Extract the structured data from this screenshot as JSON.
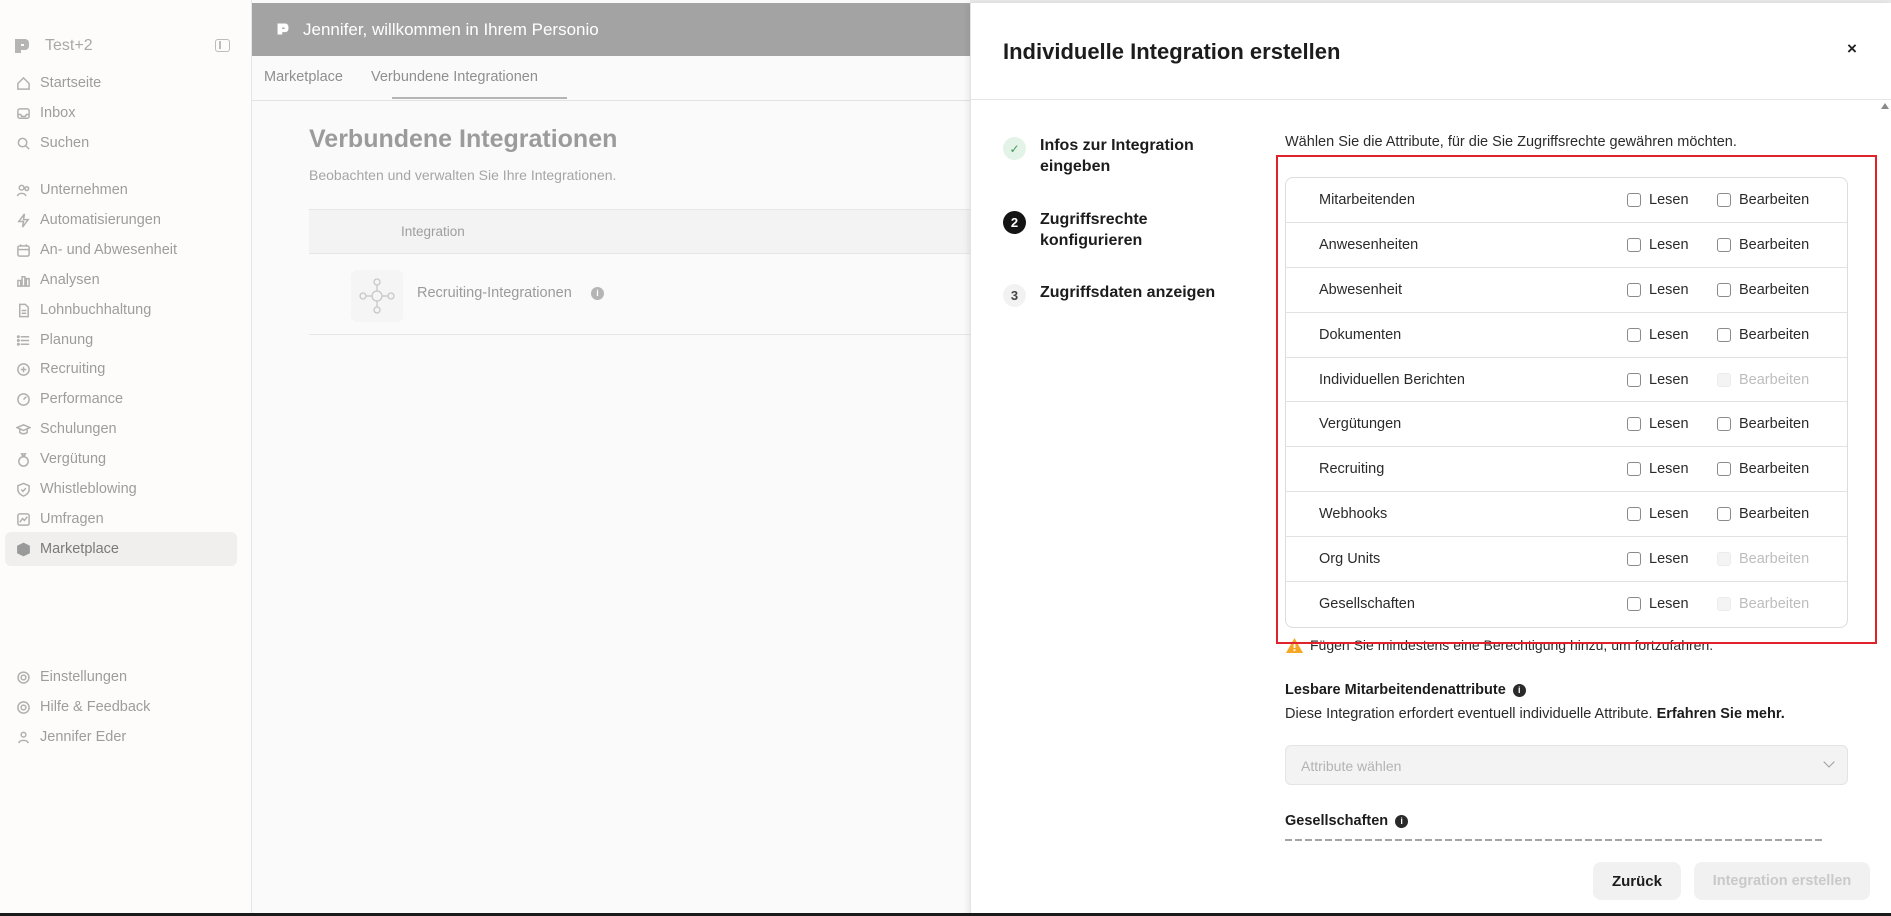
{
  "sidebar": {
    "company": "Test+2",
    "nav": [
      {
        "label": "Startseite",
        "icon": "home-icon"
      },
      {
        "label": "Inbox",
        "icon": "inbox-icon"
      },
      {
        "label": "Suchen",
        "icon": "search-icon"
      },
      {
        "label": "Unternehmen",
        "icon": "people-icon"
      },
      {
        "label": "Automatisierungen",
        "icon": "lightning-icon"
      },
      {
        "label": "An- und Abwesenheit",
        "icon": "calendar-icon"
      },
      {
        "label": "Analysen",
        "icon": "chart-icon"
      },
      {
        "label": "Lohnbuchhaltung",
        "icon": "document-icon"
      },
      {
        "label": "Planung",
        "icon": "list-icon"
      },
      {
        "label": "Recruiting",
        "icon": "recruiting-icon"
      },
      {
        "label": "Performance",
        "icon": "gauge-icon"
      },
      {
        "label": "Schulungen",
        "icon": "graduation-icon"
      },
      {
        "label": "Vergütung",
        "icon": "money-bag-icon"
      },
      {
        "label": "Whistleblowing",
        "icon": "shield-icon"
      },
      {
        "label": "Umfragen",
        "icon": "trend-icon"
      },
      {
        "label": "Marketplace",
        "icon": "cube-icon",
        "active": true
      }
    ],
    "bottom": [
      {
        "label": "Einstellungen",
        "icon": "gear-icon"
      },
      {
        "label": "Hilfe & Feedback",
        "icon": "help-icon"
      },
      {
        "label": "Jennifer Eder",
        "icon": "user-icon"
      }
    ]
  },
  "main": {
    "banner": "Jennifer, willkommen in Ihrem Personio",
    "tabs": [
      "Marketplace",
      "Verbundene Integrationen"
    ],
    "active_tab": "Verbundene Integrationen",
    "title": "Verbundene Integrationen",
    "subtitle": "Beobachten und verwalten Sie Ihre Integrationen.",
    "table_header": "Integration",
    "rows": [
      {
        "name": "Recruiting-Integrationen"
      }
    ]
  },
  "drawer": {
    "title": "Individuelle Integration erstellen",
    "close": "×",
    "steps": [
      {
        "number": "✓",
        "label": "Infos zur Integration eingeben",
        "state": "done"
      },
      {
        "number": "2",
        "label": "Zugriffsrechte konfigurieren",
        "state": "current"
      },
      {
        "number": "3",
        "label": "Zugriffsdaten anzeigen",
        "state": "todo"
      }
    ],
    "intro": "Wählen Sie die Attribute, für die Sie Zugriffsrechte gewähren möchten.",
    "read_label": "Lesen",
    "edit_label": "Bearbeiten",
    "permissions": [
      {
        "name": "Mitarbeitenden",
        "read": false,
        "edit": false,
        "edit_disabled": false
      },
      {
        "name": "Anwesenheiten",
        "read": false,
        "edit": false,
        "edit_disabled": false
      },
      {
        "name": "Abwesenheit",
        "read": false,
        "edit": false,
        "edit_disabled": false
      },
      {
        "name": "Dokumenten",
        "read": false,
        "edit": false,
        "edit_disabled": false
      },
      {
        "name": "Individuellen Berichten",
        "read": false,
        "edit": false,
        "edit_disabled": true
      },
      {
        "name": "Vergütungen",
        "read": false,
        "edit": false,
        "edit_disabled": false
      },
      {
        "name": "Recruiting",
        "read": false,
        "edit": false,
        "edit_disabled": false
      },
      {
        "name": "Webhooks",
        "read": false,
        "edit": false,
        "edit_disabled": false
      },
      {
        "name": "Org Units",
        "read": false,
        "edit": false,
        "edit_disabled": true
      },
      {
        "name": "Gesellschaften",
        "read": false,
        "edit": false,
        "edit_disabled": true
      }
    ],
    "warning": "Fügen Sie mindestens eine Berechtigung hinzu, um fortzufahren.",
    "attr_section": {
      "title": "Lesbare Mitarbeitendenattribute",
      "desc": "Diese Integration erfordert eventuell individuelle Attribute.",
      "link": "Erfahren Sie mehr.",
      "placeholder": "Attribute wählen"
    },
    "companies_section": {
      "title": "Gesellschaften"
    },
    "buttons": {
      "back": "Zurück",
      "create": "Integration erstellen"
    }
  },
  "colors": {
    "highlight": "#e0222a",
    "warning": "#f5a623",
    "banner": "#a3a3a3"
  }
}
